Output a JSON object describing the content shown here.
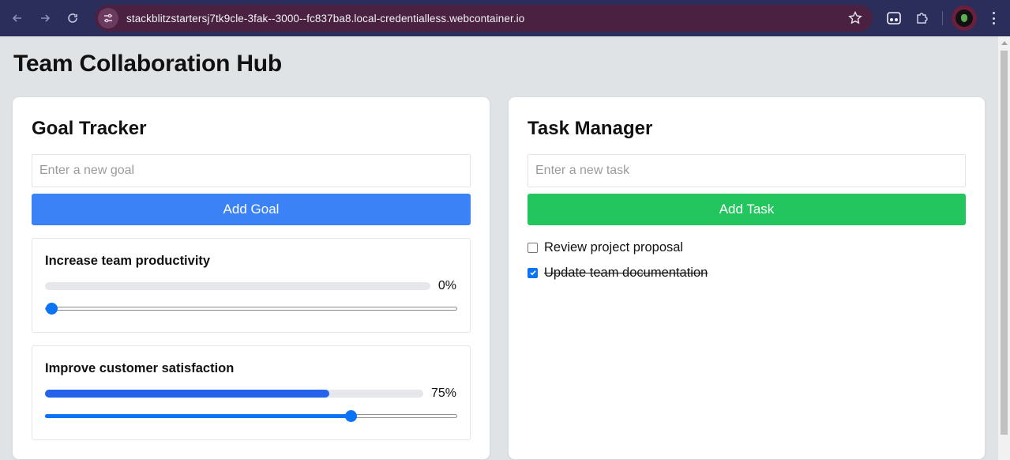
{
  "browser": {
    "url": "stackblitzstartersj7tk9cle-3fak--3000--fc837ba8.local-credentialless.webcontainer.io",
    "icons": [
      "back-icon",
      "forward-icon",
      "reload-icon",
      "site-info-icon",
      "star-icon",
      "extension-icon",
      "puzzle-icon",
      "avatar",
      "menu-icon"
    ]
  },
  "page": {
    "title": "Team Collaboration Hub"
  },
  "goal_tracker": {
    "heading": "Goal Tracker",
    "input_placeholder": "Enter a new goal",
    "add_button": "Add Goal",
    "goals": [
      {
        "title": "Increase team productivity",
        "progress_label": "0%",
        "progress": 0
      },
      {
        "title": "Improve customer satisfaction",
        "progress_label": "75%",
        "progress": 75
      }
    ]
  },
  "task_manager": {
    "heading": "Task Manager",
    "input_placeholder": "Enter a new task",
    "add_button": "Add Task",
    "tasks": [
      {
        "label": "Review project proposal",
        "completed": false
      },
      {
        "label": "Update team documentation",
        "completed": true
      }
    ]
  },
  "colors": {
    "primary_blue": "#3b82f6",
    "primary_green": "#22c55e",
    "progress_fill": "#2563eb",
    "browser_frame": "#2b2d5a"
  }
}
